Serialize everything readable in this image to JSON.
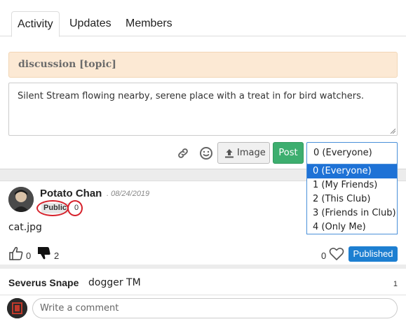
{
  "tabs": {
    "activity": "Activity",
    "updates": "Updates",
    "members": "Members"
  },
  "topic": {
    "title": "discussion [topic]"
  },
  "composer": {
    "text": "Silent Stream flowing nearby, serene place with a treat in for bird watchers.",
    "link_icon": "link-icon",
    "emoji_icon": "smile-icon",
    "image_button": "Image",
    "post_button": "Post",
    "privacy_selected": "0 (Everyone)",
    "privacy_options": [
      "0 (Everyone)",
      "1 (My Friends)",
      "2 (This Club)",
      "3 (Friends in Club)",
      "4 (Only Me)"
    ]
  },
  "post": {
    "author": "Potato Chan",
    "date": ". 08/24/2019",
    "visibility": "Public",
    "visibility_count": "0",
    "attachment": "cat.jpg",
    "likes": "0",
    "dislikes": "2",
    "favorites": "0",
    "status": "Published"
  },
  "comment": {
    "author": "Severus Snape",
    "text": "dogger TM",
    "count": "1",
    "input_placeholder": "Write a comment"
  },
  "colors": {
    "accent_blue": "#1d7fd1",
    "post_green": "#3dae6f",
    "topic_bg": "#fce9d4",
    "annotation_red": "#d6202a"
  }
}
